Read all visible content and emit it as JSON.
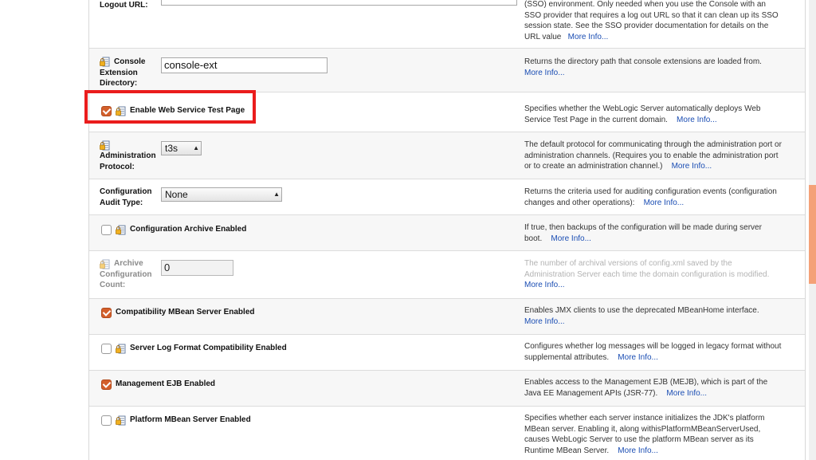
{
  "rows": {
    "logout": {
      "label": "Logout URL:",
      "desc": "(SSO) environment. Only needed when you use the Console with an SSO provider that requires a log out URL so that it can clean up its SSO session state. See the SSO provider documentation for details on the URL value",
      "more": "More Info..."
    },
    "console_ext": {
      "label": "Console Extension Directory:",
      "value": "console-ext",
      "desc": "Returns the directory path that console extensions are loaded from.",
      "more": "More Info..."
    },
    "ws_test": {
      "label": "Enable Web Service Test Page",
      "checked": true,
      "desc": "Specifies whether the WebLogic Server automatically deploys Web Service Test Page in the current domain.",
      "more": "More Info..."
    },
    "admin_proto": {
      "label": "Administration Protocol:",
      "value": "t3s",
      "desc": "The default protocol for communicating through the administration port or administration channels. (Requires you to enable the administration port or to create an administration channel.)",
      "more": "More Info..."
    },
    "audit": {
      "label": "Configuration Audit Type:",
      "value": "None",
      "desc": "Returns the criteria used for auditing configuration events (configuration changes and other operations):",
      "more": "More Info..."
    },
    "archive": {
      "label": "Configuration Archive Enabled",
      "checked": false,
      "desc": "If true, then backups of the configuration will be made during server boot.",
      "more": "More Info..."
    },
    "archive_count": {
      "label": "Archive Configuration Count:",
      "value": "0",
      "desc": "The number of archival versions of config.xml saved by the Administration Server each time the domain configuration is modified.",
      "more": "More Info..."
    },
    "compat_mbean": {
      "label": "Compatibility MBean Server Enabled",
      "checked": true,
      "desc": "Enables JMX clients to use the deprecated MBeanHome interface.",
      "more": "More Info..."
    },
    "log_format": {
      "label": "Server Log Format Compatibility Enabled",
      "checked": false,
      "desc": "Configures whether log messages will be logged in legacy format without supplemental attributes.",
      "more": "More Info..."
    },
    "mgmt_ejb": {
      "label": "Management EJB Enabled",
      "checked": true,
      "desc": "Enables access to the Management EJB (MEJB), which is part of the Java EE Management APIs (JSR-77).",
      "more": "More Info..."
    },
    "platform_mbean": {
      "label": "Platform MBean Server Enabled",
      "checked": false,
      "desc": "Specifies whether each server instance initializes the JDK's platform MBean server. Enabling it, along withisPlatformMBeanServerUsed, causes WebLogic Server to use the platform MBean server as its Runtime MBean Server.",
      "more": "More Info..."
    }
  },
  "icons": {
    "lock": "lock-config-icon"
  },
  "colors": {
    "checked": "#d35f2b",
    "highlight": "#ea1c1c",
    "link": "#1a4db3",
    "scroll_thumb": "#f4a177"
  }
}
